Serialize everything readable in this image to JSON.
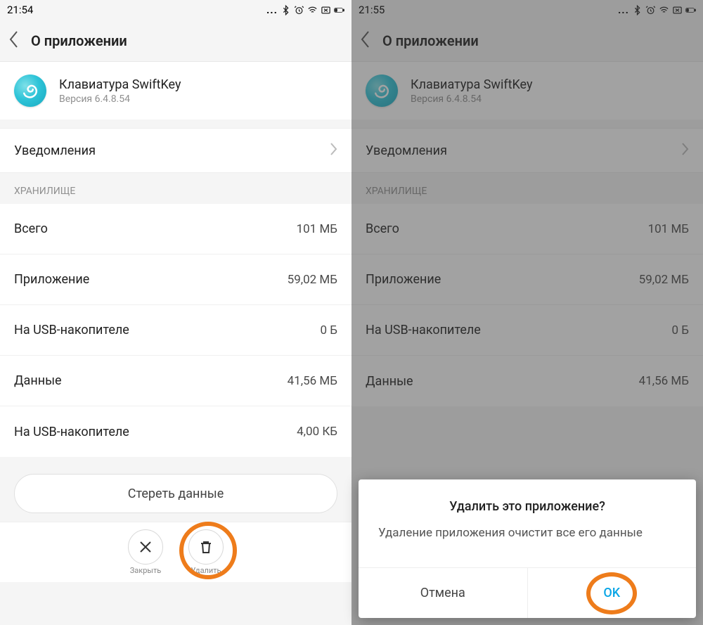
{
  "left": {
    "status": {
      "time": "21:54",
      "dots": "..."
    },
    "header": {
      "title": "О приложении"
    },
    "app": {
      "name": "Клавиатура SwiftKey",
      "version": "Версия 6.4.8.54"
    },
    "notifications": "Уведомления",
    "storage": {
      "section": "ХРАНИЛИЩЕ",
      "rows": [
        {
          "label": "Всего",
          "value": "101 МБ"
        },
        {
          "label": "Приложение",
          "value": "59,02 МБ"
        },
        {
          "label": "На USB-накопителе",
          "value": "0 Б"
        },
        {
          "label": "Данные",
          "value": "41,56 МБ"
        },
        {
          "label": "На USB-накопителе",
          "value": "4,00 КБ"
        }
      ]
    },
    "clear_data": "Стереть данные",
    "actions": {
      "close": "Закрыть",
      "delete": "Удалить"
    }
  },
  "right": {
    "status": {
      "time": "21:55",
      "dots": "..."
    },
    "header": {
      "title": "О приложении"
    },
    "app": {
      "name": "Клавиатура SwiftKey",
      "version": "Версия 6.4.8.54"
    },
    "notifications": "Уведомления",
    "storage": {
      "section": "ХРАНИЛИЩЕ",
      "rows": [
        {
          "label": "Всего",
          "value": "101 МБ"
        },
        {
          "label": "Приложение",
          "value": "59,02 МБ"
        },
        {
          "label": "На USB-накопителе",
          "value": "0 Б"
        },
        {
          "label": "Данные",
          "value": "41,56 МБ"
        }
      ]
    },
    "dialog": {
      "title": "Удалить это приложение?",
      "message": "Удаление приложения очистит все его данные",
      "cancel": "Отмена",
      "ok": "OK"
    }
  }
}
